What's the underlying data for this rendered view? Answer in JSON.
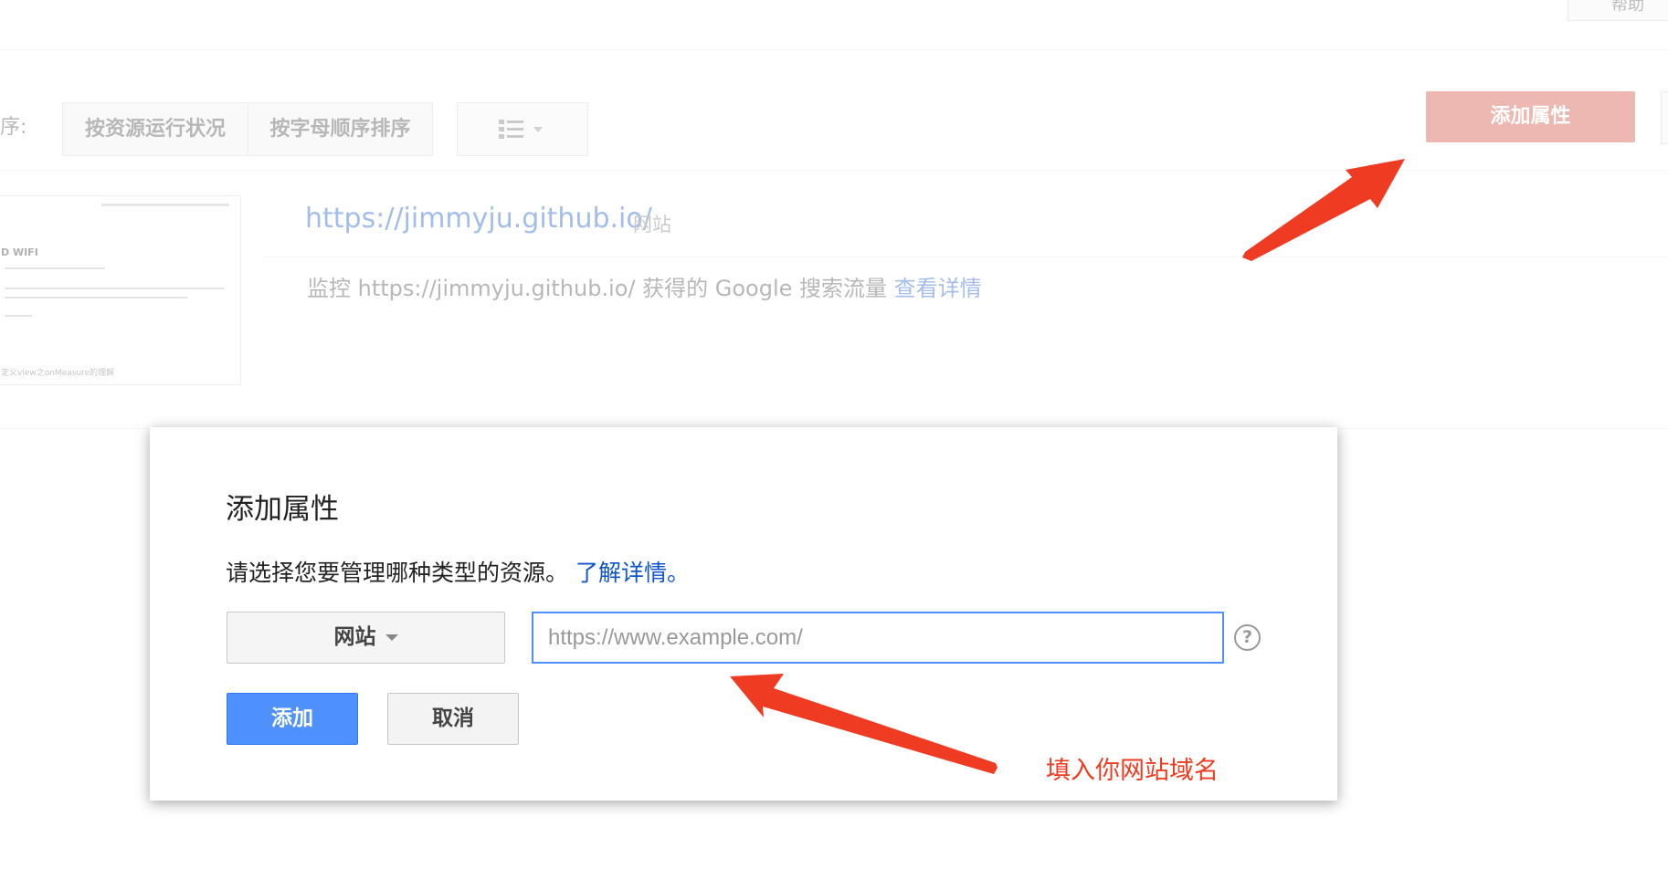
{
  "header": {
    "top_button": "帮助"
  },
  "toolbar": {
    "sort_label": "序:",
    "sort_options": [
      "按资源运行状况",
      "按字母顺序排序"
    ],
    "add_property_button": "添加属性"
  },
  "property": {
    "url": "https://jimmyju.github.io/",
    "type": "网站",
    "monitor_text": "监控 https://jimmyju.github.io/ 获得的 Google 搜索流量",
    "details_link": "查看详情",
    "thumbnail": {
      "title": "D WIFI",
      "caption": "定义view之onMeasure的理解"
    }
  },
  "dialog": {
    "title": "添加属性",
    "description": "请选择您要管理哪种类型的资源。",
    "learn_more": "了解详情。",
    "type_select": "网站",
    "url_placeholder": "https://www.example.com/",
    "help": "?",
    "add_button": "添加",
    "cancel_button": "取消"
  },
  "annotation": {
    "text": "填入你网站域名",
    "color": "#ee3b22"
  },
  "colors": {
    "accent_red": "#d14836",
    "accent_blue": "#4d90fe",
    "link": "#1155cc"
  }
}
